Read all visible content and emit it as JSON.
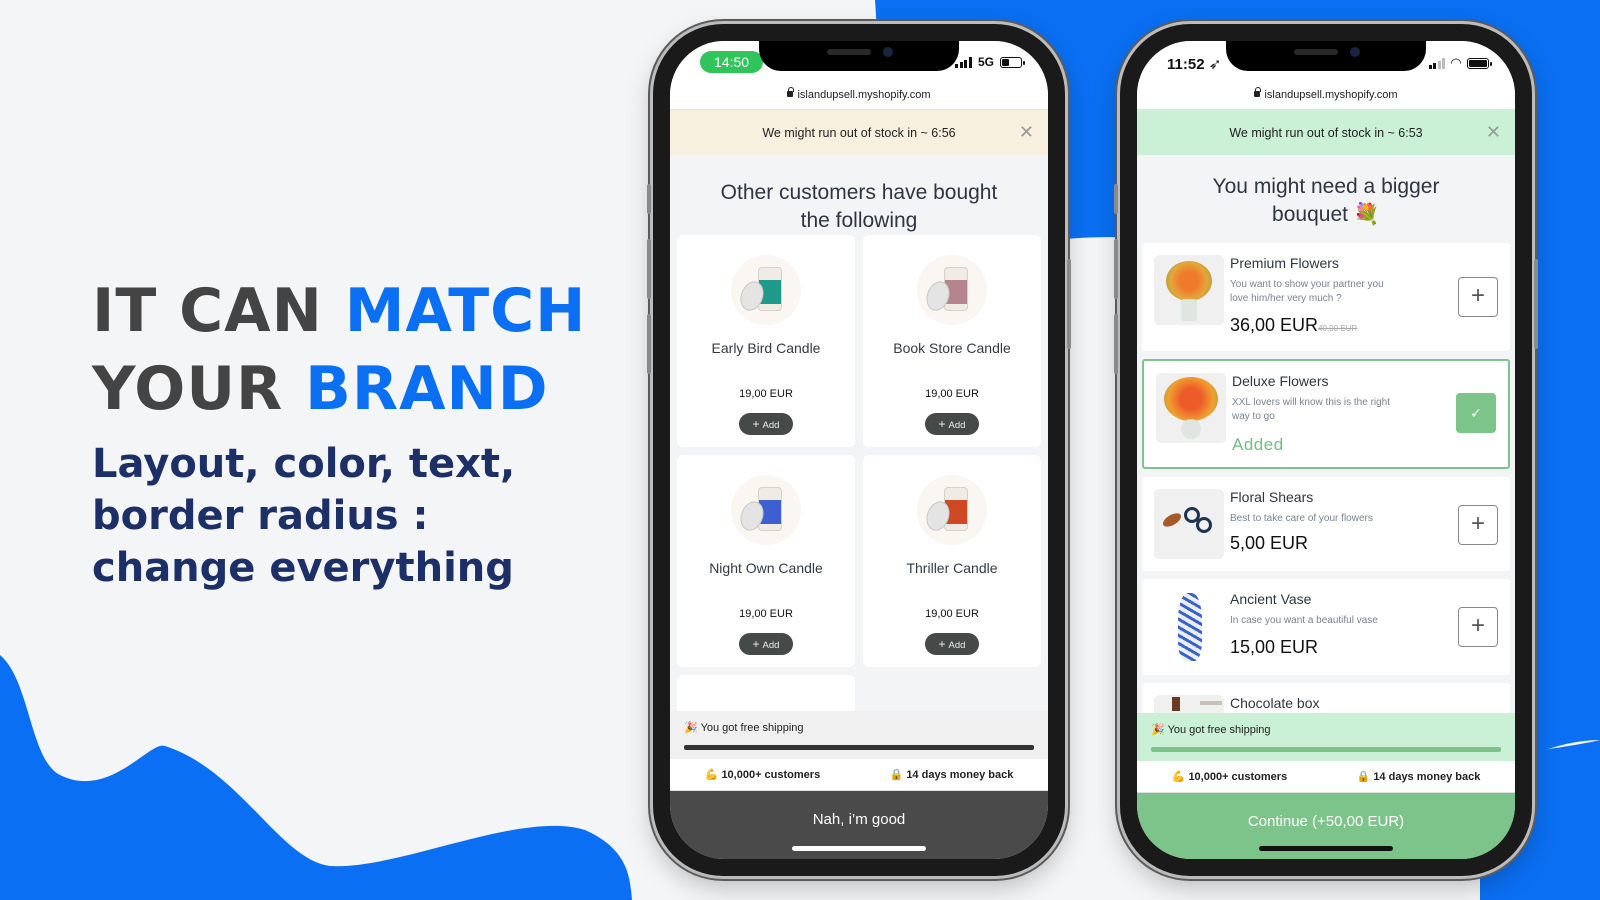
{
  "hero": {
    "title_line1_plain": "IT CAN",
    "title_line1_accent": "MATCH",
    "title_line2_plain": "YOUR",
    "title_line2_accent": "BRAND",
    "subtitle_line1": "Layout, color, text,",
    "subtitle_line2": "border radius :",
    "subtitle_line3": "change everything"
  },
  "colors": {
    "brand_blue": "#0a6ff2",
    "title_gray": "#444444",
    "subtitle_navy": "#1c2f66",
    "left_accent_dark": "#454a48",
    "right_accent_green": "#7cc48a"
  },
  "phone_left": {
    "status": {
      "time": "14:50",
      "network": "5G"
    },
    "url": "islandupsell.myshopify.com",
    "stock_banner": "We might run out of stock in ~ 6:56",
    "heading_line1": "Other customers have bought",
    "heading_line2": "the following",
    "products": [
      {
        "name": "Early Bird Candle",
        "price": "19,00 EUR",
        "add_label": "Add",
        "label_color": "#1f9a8a"
      },
      {
        "name": "Book Store Candle",
        "price": "19,00 EUR",
        "add_label": "Add",
        "label_color": "#b5848f"
      },
      {
        "name": "Night Own Candle",
        "price": "19,00 EUR",
        "add_label": "Add",
        "label_color": "#3d5fd1"
      },
      {
        "name": "Thriller Candle",
        "price": "19,00 EUR",
        "add_label": "Add",
        "label_color": "#cf4a24"
      }
    ],
    "shipping": {
      "text": "You got free shipping",
      "emoji": "🎉",
      "progress": 1.0
    },
    "trust": [
      {
        "emoji": "💪",
        "text": "10,000+ customers"
      },
      {
        "emoji": "🔒",
        "text": "14 days money back"
      }
    ],
    "cta": "Nah, i’m good"
  },
  "phone_right": {
    "status": {
      "time": "11:52"
    },
    "url": "islandupsell.myshopify.com",
    "stock_banner": "We might run out of stock in ~ 6:53",
    "heading_line1": "You might need a bigger",
    "heading_line2": "bouquet 💐",
    "products": [
      {
        "name": "Premium Flowers",
        "desc": "You want to show your partner you love him/her very much ?",
        "price": "36,00 EUR",
        "compare_price": "40,00 EUR",
        "state": "add"
      },
      {
        "name": "Deluxe Flowers",
        "desc": "XXL lovers will know this is the right way to go",
        "status_text": "Added",
        "state": "added"
      },
      {
        "name": "Floral Shears",
        "desc": "Best to take care of your flowers",
        "price": "5,00 EUR",
        "state": "add"
      },
      {
        "name": "Ancient Vase",
        "desc": "In case you want a beautiful vase",
        "price": "15,00 EUR",
        "state": "add"
      },
      {
        "name": "Chocolate box"
      }
    ],
    "shipping": {
      "text": "You got free shipping",
      "emoji": "🎉",
      "progress": 1.0
    },
    "trust": [
      {
        "emoji": "💪",
        "text": "10,000+ customers"
      },
      {
        "emoji": "🔒",
        "text": "14 days money back"
      }
    ],
    "cta": "Continue (+50,00 EUR)"
  }
}
